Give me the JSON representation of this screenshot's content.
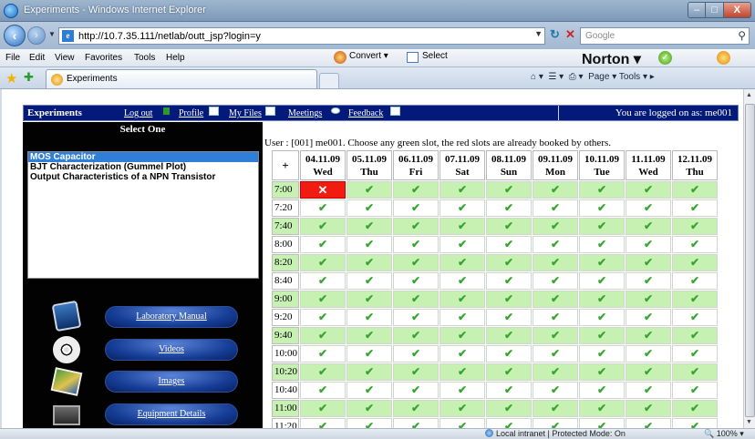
{
  "browser": {
    "window_title": "Experiments - Windows Internet Explorer",
    "window_buttons": [
      "–",
      "□",
      "X"
    ],
    "url": "http://10.7.35.111/netlab/outt_jsp?login=y",
    "search_placeholder": "Google",
    "menus": [
      "File",
      "Edit",
      "View",
      "Favorites",
      "Tools",
      "Help"
    ],
    "convert_label": "Convert",
    "select_label": "Select",
    "norton_label": "Norton",
    "tab_label": "Experiments",
    "command_bar": "Page ▾   Tools ▾",
    "status_zone": "Local intranet | Protected Mode: On",
    "zoom": "100%"
  },
  "nav": {
    "brand": "Experiments",
    "links": [
      "Log out",
      "Profile",
      "My Files",
      "Meetings",
      "Feedback"
    ],
    "logged_on": "You are logged on as: me001"
  },
  "sidebar": {
    "heading": "Select One",
    "experiments": [
      "MOS Capacitor",
      "BJT Characterization (Gummel Plot)",
      "Output Characteristics of a NPN Transistor"
    ],
    "selected_index": 0,
    "buttons": [
      "Laboratory Manual",
      "Videos",
      "Images",
      "Equipment Details"
    ]
  },
  "booking": {
    "message": "User : [001] me001. Choose any green slot, the red slots are already booked by others.",
    "corner": "+",
    "dates": [
      "04.11.09",
      "05.11.09",
      "06.11.09",
      "07.11.09",
      "08.11.09",
      "09.11.09",
      "10.11.09",
      "11.11.09",
      "12.11.09"
    ],
    "days": [
      "Wed",
      "Thu",
      "Fri",
      "Sat",
      "Sun",
      "Mon",
      "Tue",
      "Wed",
      "Thu"
    ],
    "times": [
      "7:00",
      "7:20",
      "7:40",
      "8:00",
      "8:20",
      "8:40",
      "9:00",
      "9:20",
      "9:40",
      "10:00",
      "10:20",
      "10:40",
      "11:00",
      "11:20"
    ],
    "available_symbol": "✔",
    "booked_symbol": "✕",
    "booked_slots": [
      [
        0,
        0
      ]
    ],
    "colors": {
      "available": "#c6f1b3",
      "booked": "#f21b0f",
      "nav": "#041a7a"
    }
  }
}
